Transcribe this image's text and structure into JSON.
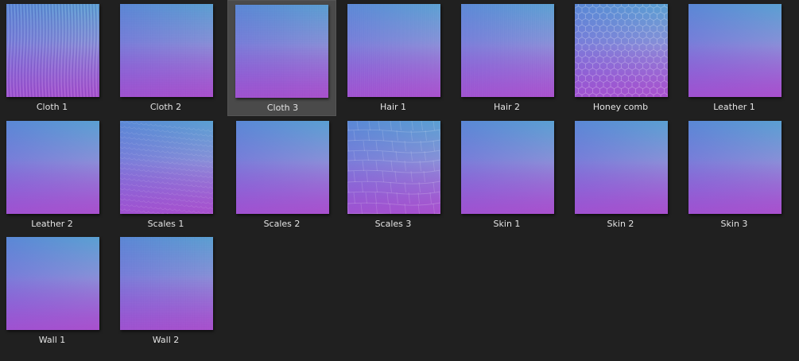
{
  "selected": "Cloth 3",
  "items": [
    {
      "label": "Cloth 1",
      "pattern": "vertical-fibers"
    },
    {
      "label": "Cloth 2",
      "pattern": "fine-weave"
    },
    {
      "label": "Cloth 3",
      "pattern": "fine-weave"
    },
    {
      "label": "Hair 1",
      "pattern": "vertical-strands"
    },
    {
      "label": "Hair 2",
      "pattern": "vertical-strands"
    },
    {
      "label": "Honey comb",
      "pattern": "hexagons"
    },
    {
      "label": "Leather 1",
      "pattern": "smooth"
    },
    {
      "label": "Leather 2",
      "pattern": "smooth"
    },
    {
      "label": "Scales 1",
      "pattern": "small-scales"
    },
    {
      "label": "Scales 2",
      "pattern": "smooth"
    },
    {
      "label": "Scales 3",
      "pattern": "croc-scales"
    },
    {
      "label": "Skin 1",
      "pattern": "smooth"
    },
    {
      "label": "Skin 2",
      "pattern": "smooth"
    },
    {
      "label": "Skin 3",
      "pattern": "smooth"
    },
    {
      "label": "Wall 1",
      "pattern": "smooth"
    },
    {
      "label": "Wall 2",
      "pattern": "fine-weave"
    }
  ]
}
